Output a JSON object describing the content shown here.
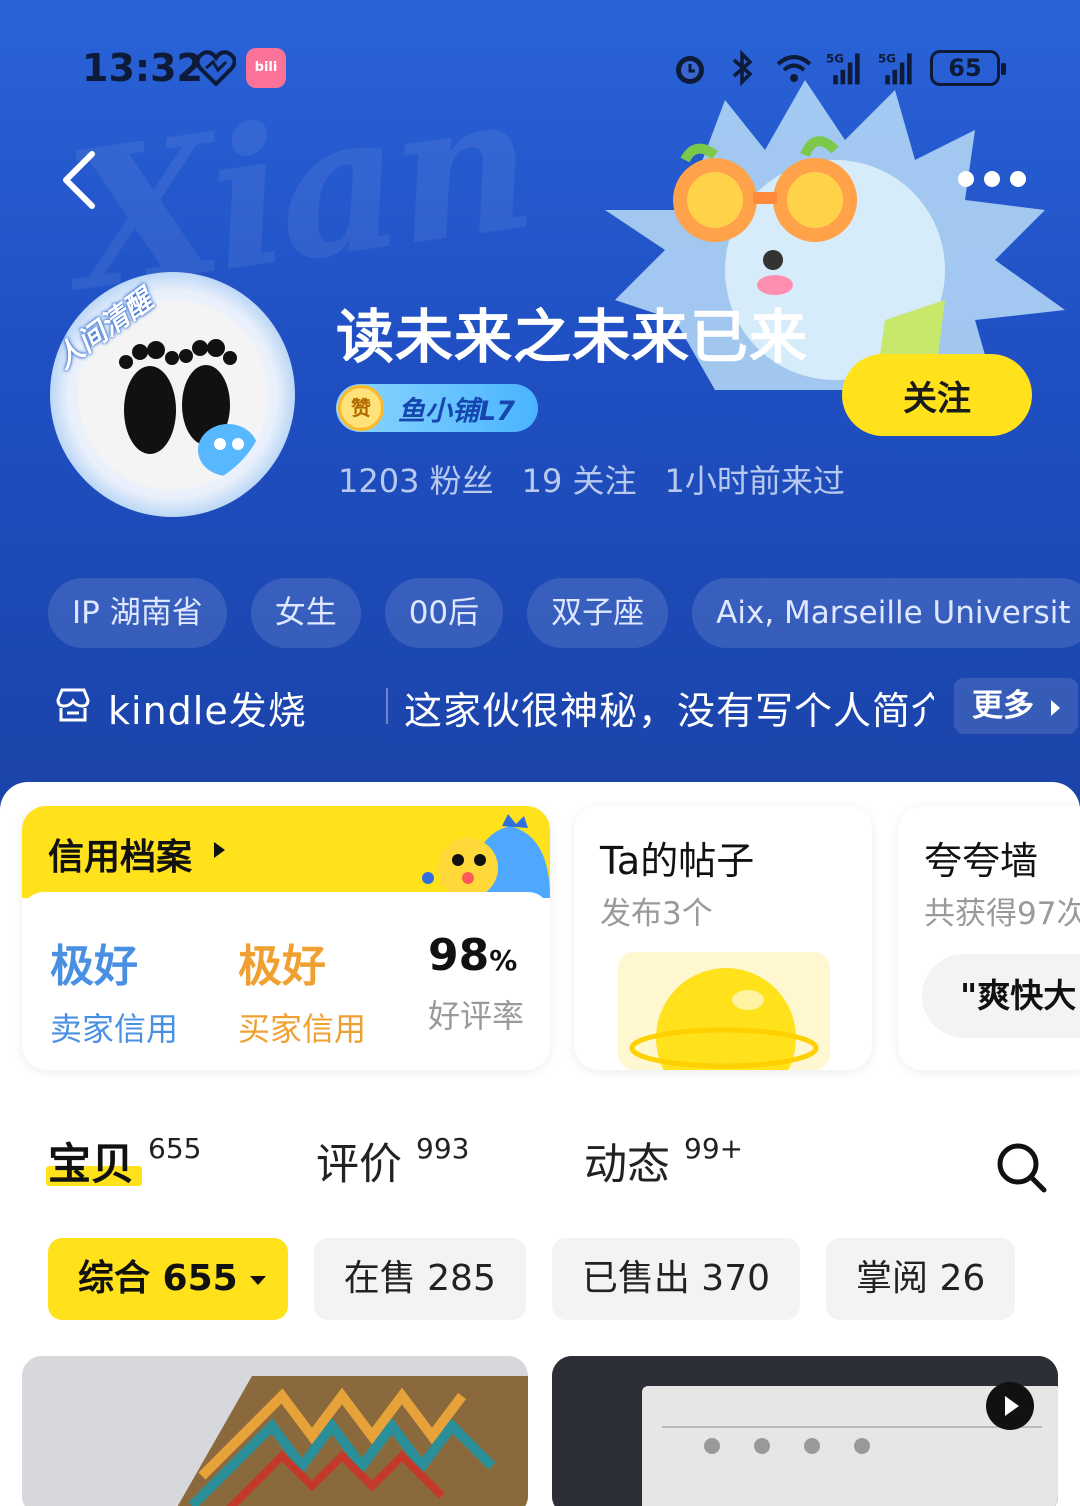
{
  "status_bar": {
    "time": "13:32",
    "app_icon": "bilibili",
    "battery": "65",
    "network": "5G"
  },
  "profile": {
    "nickname": "读未来之未来已来",
    "avatar_badge": "人间清醒",
    "level_badge_icon": "赞",
    "level": "鱼小铺L7",
    "follow_label": "关注",
    "stats": [
      "1203 粉丝",
      "19 关注",
      "1小时前来过"
    ],
    "tags": [
      "IP 湖南省",
      "女生",
      "00后",
      "双子座",
      "Aix, Marseille Universit"
    ],
    "bio_main": "kindle发烧",
    "bio_desc": "这家伙很神秘，没有写个人简介",
    "bio_more": "更多"
  },
  "credit": {
    "title": "信用档案",
    "seller_value": "极好",
    "seller_label": "卖家信用",
    "buyer_value": "极好",
    "buyer_label": "买家信用",
    "rate_value": "98",
    "rate_unit": "%",
    "rate_label": "好评率"
  },
  "posts": {
    "title": "Ta的帖子",
    "subtitle": "发布3个"
  },
  "praise": {
    "title": "夸夸墙",
    "subtitle": "共获得97次",
    "quote": "\"爽快大"
  },
  "tabs": [
    {
      "label": "宝贝",
      "count": "655"
    },
    {
      "label": "评价",
      "count": "993"
    },
    {
      "label": "动态",
      "count": "99+"
    }
  ],
  "filters": [
    "综合 655",
    "在售 285",
    "已售出 370",
    "掌阅 26"
  ],
  "colors": {
    "header_blue": "#1f4fc2",
    "accent_yellow": "#ffe11c",
    "seller_blue": "#4a90e2",
    "buyer_orange": "#f0a030"
  }
}
